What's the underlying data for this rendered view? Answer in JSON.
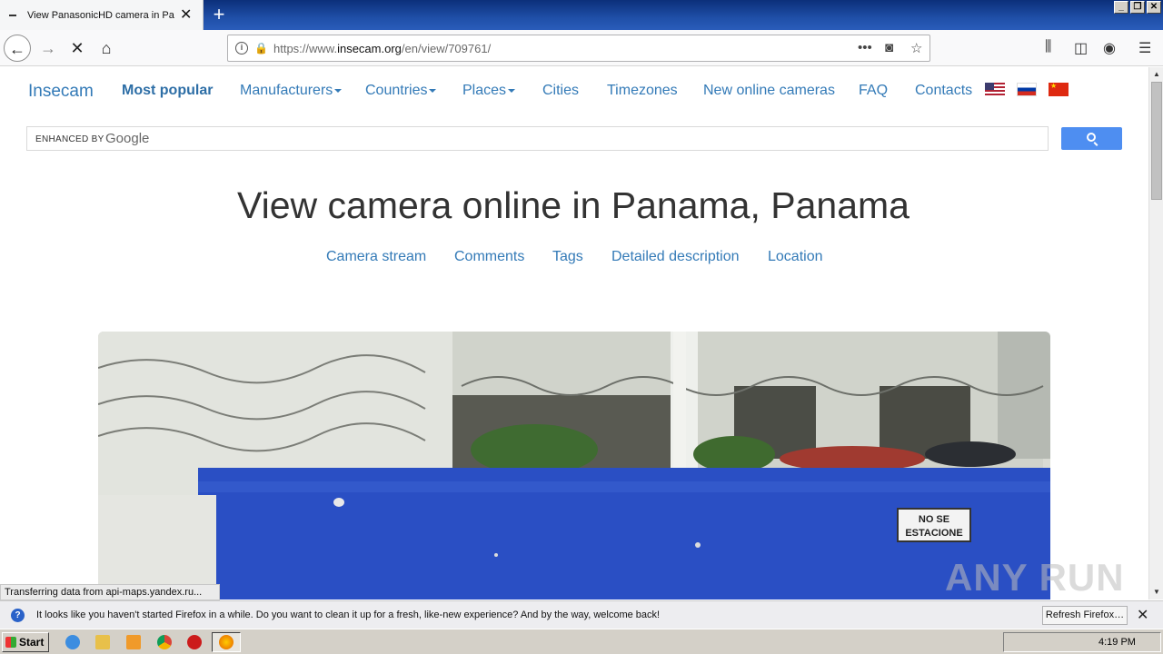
{
  "browser": {
    "tab_title": "View PanasonicHD camera in Panama",
    "url_prefix": "https://www.",
    "url_domain": "insecam.org",
    "url_path": "/en/view/709761/",
    "status_text": "Transferring data from api-maps.yandex.ru...",
    "notification": "It looks like you haven't started Firefox in a while. Do you want to clean it up for a fresh, like-new experience? And by the way, welcome back!",
    "refresh_label": "Refresh Firefox…"
  },
  "site": {
    "brand": "Insecam",
    "nav": {
      "most_popular": "Most popular",
      "manufacturers": "Manufacturers",
      "countries": "Countries",
      "places": "Places",
      "cities": "Cities",
      "timezones": "Timezones",
      "new_online": "New online cameras",
      "faq": "FAQ",
      "contacts": "Contacts"
    },
    "search": {
      "enhanced": "ENHANCED BY",
      "google": "Google"
    },
    "heading": "View camera online in Panama, Panama",
    "subnav": {
      "stream": "Camera stream",
      "comments": "Comments",
      "tags": "Tags",
      "description": "Detailed description",
      "location": "Location"
    },
    "sign_text_1": "NO SE",
    "sign_text_2": "ESTACIONE"
  },
  "taskbar": {
    "start": "Start",
    "clock": "4:19 PM"
  },
  "watermark": "ANY RUN",
  "colors": {
    "link": "#337ab7",
    "search_button": "#4e8ef1",
    "wall_blue": "#2a4fc4"
  }
}
